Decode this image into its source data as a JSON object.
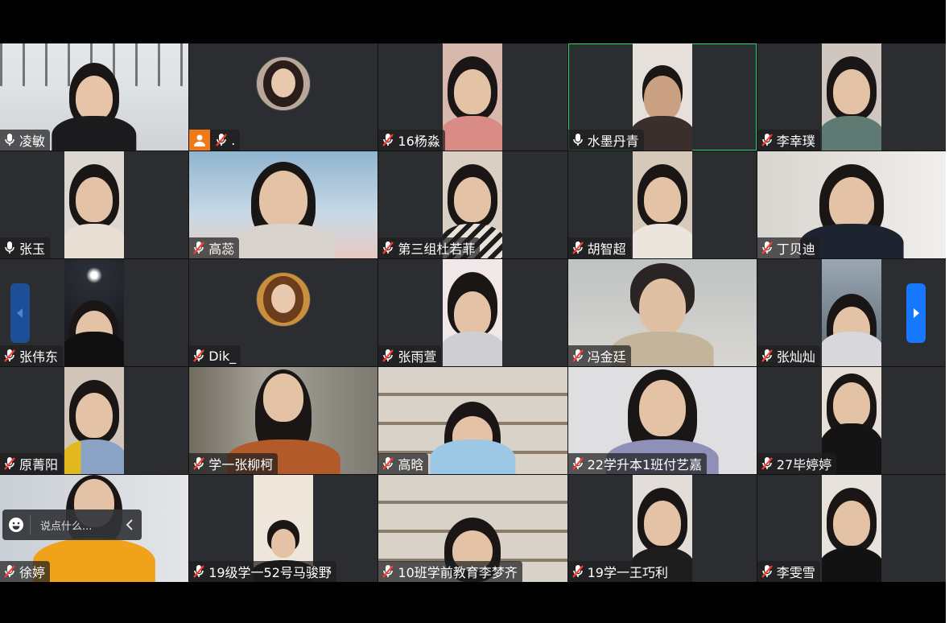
{
  "participants": [
    {
      "name": "凌敏",
      "mic": "on"
    },
    {
      "name": ".",
      "mic": "muted"
    },
    {
      "name": "16杨淼",
      "mic": "muted"
    },
    {
      "name": "水墨丹青",
      "mic": "on"
    },
    {
      "name": "李幸璞",
      "mic": "muted"
    },
    {
      "name": "张玉",
      "mic": "on"
    },
    {
      "name": "高蕊",
      "mic": "muted"
    },
    {
      "name": "第三组杜若菲",
      "mic": "muted"
    },
    {
      "name": "胡智超",
      "mic": "muted"
    },
    {
      "name": "丁贝迪",
      "mic": "muted"
    },
    {
      "name": "张伟东",
      "mic": "muted"
    },
    {
      "name": "Dik_",
      "mic": "muted"
    },
    {
      "name": "张雨萱",
      "mic": "muted"
    },
    {
      "name": "冯金廷",
      "mic": "muted"
    },
    {
      "name": "张灿灿",
      "mic": "muted"
    },
    {
      "name": "原菁阳",
      "mic": "muted"
    },
    {
      "name": "学一张柳柯",
      "mic": "muted"
    },
    {
      "name": "高晗",
      "mic": "muted"
    },
    {
      "name": "22学升本1班付艺嘉",
      "mic": "muted"
    },
    {
      "name": "27毕婷婷",
      "mic": "muted"
    },
    {
      "name": "徐婷",
      "mic": "muted"
    },
    {
      "name": "19级学一52号马骏野",
      "mic": "muted"
    },
    {
      "name": "10班学前教育李梦齐",
      "mic": "muted"
    },
    {
      "name": "19学一王巧利",
      "mic": "muted"
    },
    {
      "name": "李雯雪",
      "mic": "muted"
    }
  ],
  "chat": {
    "placeholder": "说点什么..."
  },
  "colors": {
    "active_speaker_border": "#2fd36b",
    "nav_next": "#1678ff",
    "nav_prev": "#1d4f99",
    "avatar_orange": "#f07a18"
  },
  "icons": {
    "prev": "chevron-left-icon",
    "next": "chevron-right-icon",
    "emoji": "smiley-icon",
    "collapse": "chevron-left-icon"
  }
}
